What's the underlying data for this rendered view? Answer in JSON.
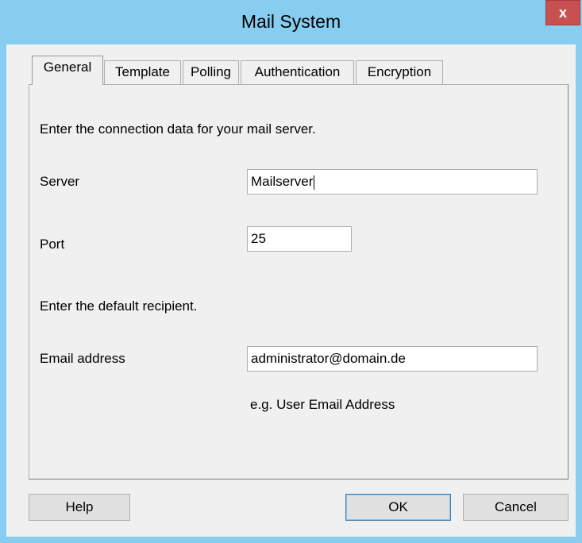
{
  "window": {
    "title": "Mail System",
    "close_label": "x"
  },
  "tabs": [
    {
      "label": "General",
      "active": true
    },
    {
      "label": "Template",
      "active": false
    },
    {
      "label": "Polling",
      "active": false
    },
    {
      "label": "Authentication",
      "active": false
    },
    {
      "label": "Encryption",
      "active": false
    }
  ],
  "general": {
    "intro": "Enter the connection data for your mail server.",
    "server_label": "Server",
    "server_value": "Mailserver",
    "port_label": "Port",
    "port_value": "25",
    "recipient_intro": "Enter the default recipient.",
    "email_label": "Email address",
    "email_value": "administrator@domain.de",
    "email_hint": "e.g. User Email Address"
  },
  "buttons": {
    "help": "Help",
    "ok": "OK",
    "cancel": "Cancel"
  }
}
